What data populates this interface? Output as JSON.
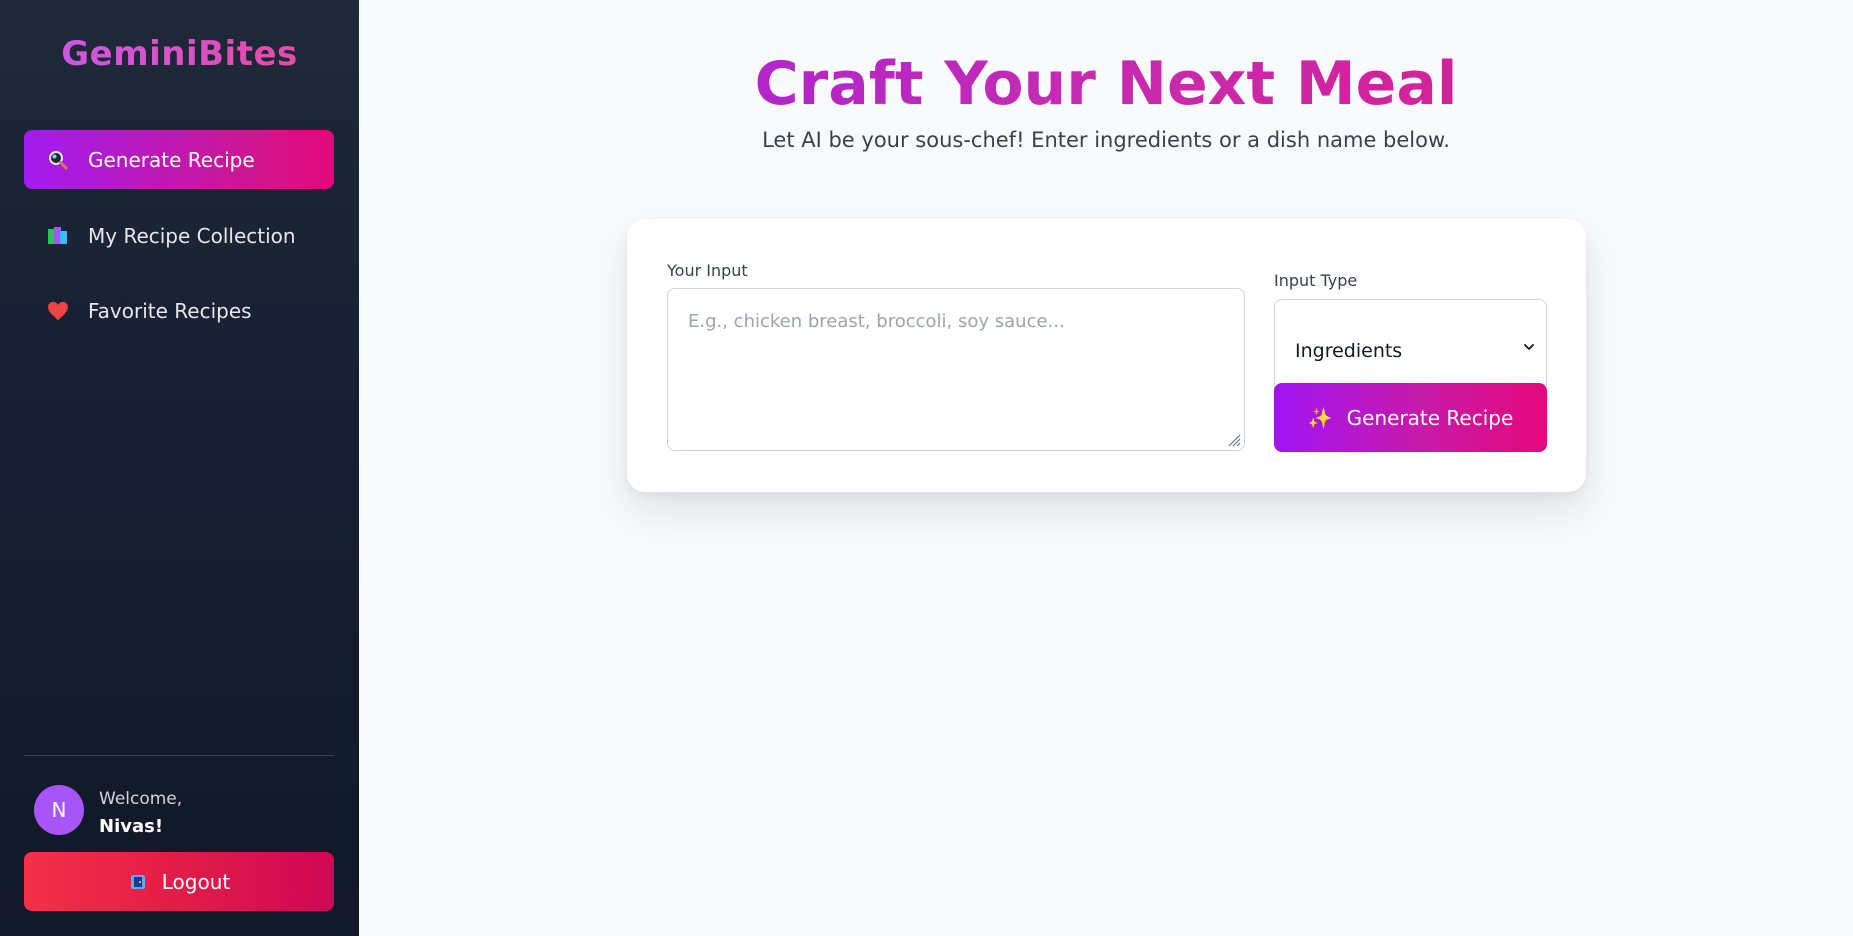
{
  "brand": "GeminiBites",
  "sidebar": {
    "items": [
      {
        "label": "Generate Recipe",
        "icon": "magnifier-icon",
        "active": true
      },
      {
        "label": "My Recipe Collection",
        "icon": "books-icon",
        "active": false
      },
      {
        "label": "Favorite Recipes",
        "icon": "heart-icon",
        "active": false
      }
    ]
  },
  "user": {
    "initial": "N",
    "greeting": "Welcome,",
    "name": "Nivas!"
  },
  "logout_label": "Logout",
  "main": {
    "title": "Craft Your Next Meal",
    "subtitle": "Let AI be your sous-chef! Enter ingredients or a dish name below."
  },
  "form": {
    "input_label": "Your Input",
    "input_placeholder": "E.g., chicken breast, broccoli, soy sauce...",
    "input_value": "",
    "type_label": "Input Type",
    "type_selected": "Ingredients",
    "submit_label": "Generate Recipe"
  },
  "colors": {
    "accent_purple": "#a014f5",
    "accent_pink": "#e5087c",
    "logout_red": "#e11d48",
    "avatar": "#a855f7",
    "sidebar_bg": "#1f2937"
  }
}
